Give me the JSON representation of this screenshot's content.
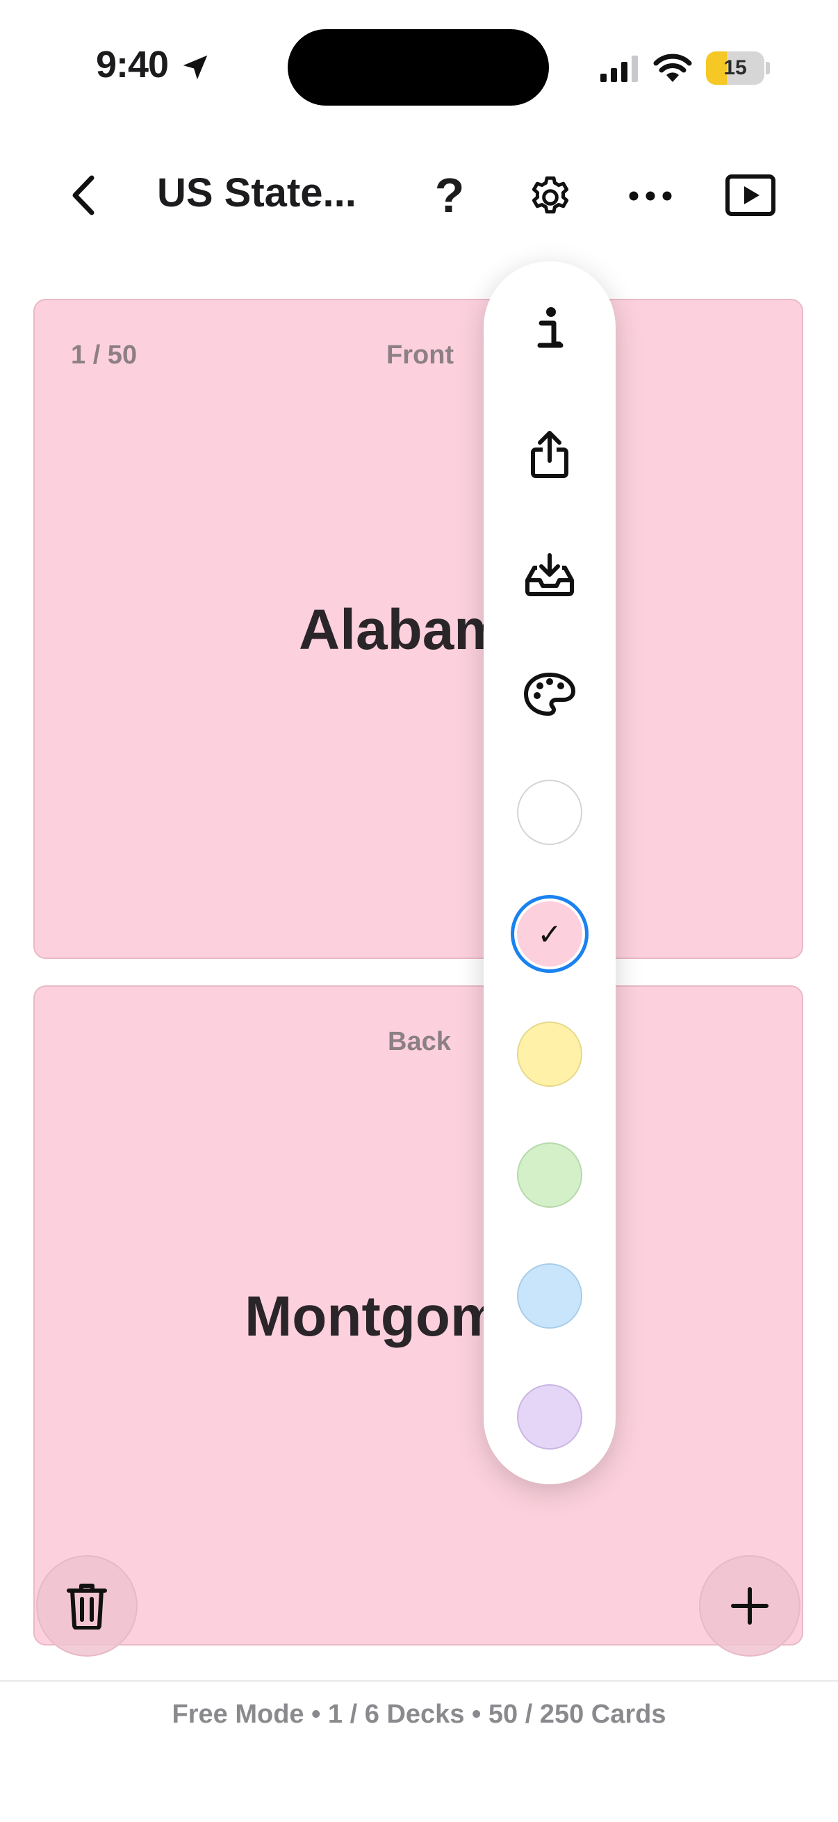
{
  "status_bar": {
    "time": "9:40",
    "battery": "15",
    "icons": [
      "location-arrow-icon",
      "cellular-signal-icon",
      "wifi-icon",
      "battery-icon"
    ]
  },
  "nav": {
    "back_icon": "chevron-left-icon",
    "title": "US State...",
    "help_label": "?",
    "settings_icon": "gear-icon",
    "more_icon": "ellipsis-icon",
    "play_icon": "play-rectangle-icon"
  },
  "front_card": {
    "counter": "1 / 50",
    "side_label": "Front",
    "text": "Alabama"
  },
  "back_card": {
    "side_label": "Back",
    "text": "Montgomery"
  },
  "menu": {
    "items": [
      "info-icon",
      "share-icon",
      "import-tray-icon",
      "palette-icon"
    ],
    "check_glyph": "✓",
    "swatches": [
      {
        "name": "white",
        "color": "#ffffff",
        "selected": false
      },
      {
        "name": "pink",
        "color": "#fcd1dd",
        "selected": true
      },
      {
        "name": "yellow",
        "color": "#fff2a8",
        "selected": false
      },
      {
        "name": "green",
        "color": "#d3f0c9",
        "selected": false
      },
      {
        "name": "blue",
        "color": "#c9e5fb",
        "selected": false
      },
      {
        "name": "purple",
        "color": "#e5d5f7",
        "selected": false
      }
    ],
    "selected_ring_color": "#1a82f0"
  },
  "actions": {
    "delete_icon": "trash-icon",
    "add_icon": "plus-icon"
  },
  "footer": {
    "text": "Free Mode • 1 / 6 Decks • 50 / 250 Cards"
  },
  "colors": {
    "card_background": "#fcd1dd",
    "accent": "#1a82f0"
  }
}
